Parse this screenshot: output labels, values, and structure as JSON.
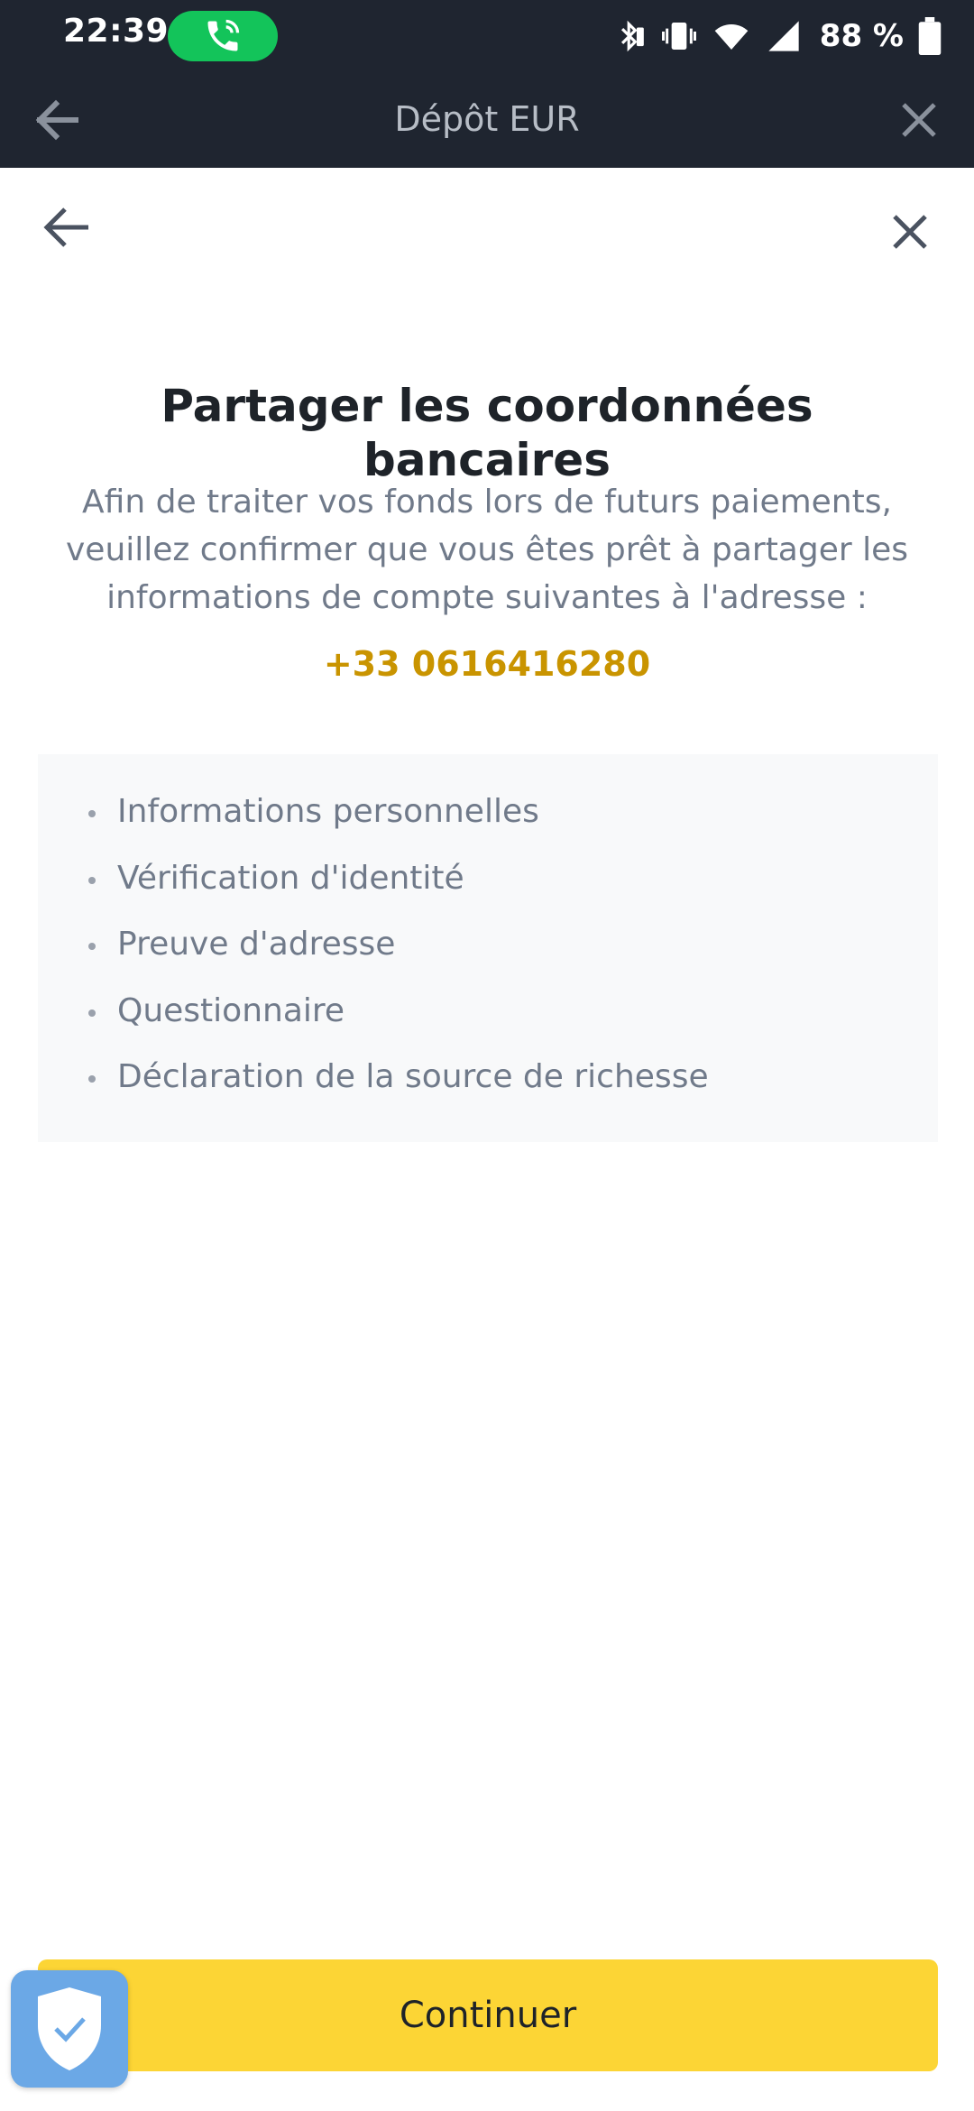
{
  "status_bar": {
    "time": "22:39",
    "battery_text": "88 %",
    "icons": [
      "phone-call-icon",
      "bluetooth-icon",
      "vibrate-icon",
      "wifi-icon",
      "signal-icon",
      "battery-icon"
    ]
  },
  "header": {
    "title": "Dépôt EUR"
  },
  "content": {
    "heading": "Partager les coordonnées bancaires",
    "description": "Afin de traiter vos fonds lors de futurs paiements, veuillez confirmer que vous êtes prêt à partager les informations de compte suivantes à l'adresse :",
    "phone": "+33 0616416280",
    "items": [
      "Informations personnelles",
      "Vérification d'identité",
      "Preuve d'adresse",
      "Questionnaire",
      "Déclaration de la source de richesse"
    ]
  },
  "footer": {
    "continue_label": "Continuer"
  },
  "colors": {
    "header_bg": "#1f2530",
    "accent_gold": "#c99400",
    "button_yellow": "#fcd535",
    "call_green": "#13c45a",
    "shield_blue": "#6ba8e6"
  }
}
